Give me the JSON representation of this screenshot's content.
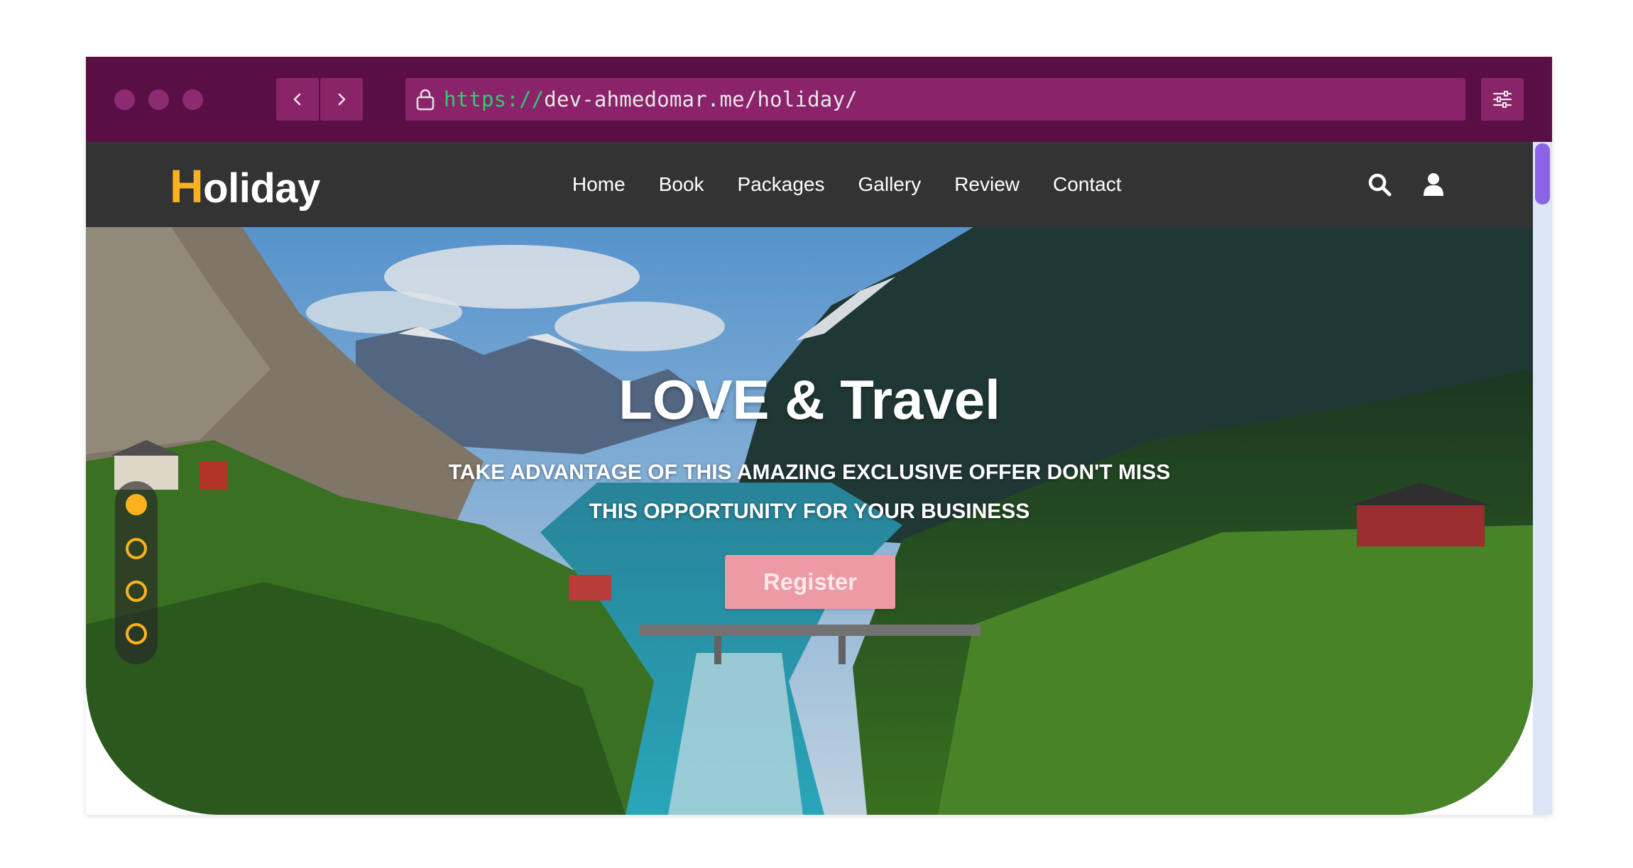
{
  "browser": {
    "url_protocol": "https://",
    "url_rest": "dev-ahmedomar.me/holiday/",
    "colors": {
      "frame": "#5a0f44",
      "control": "#8a2469"
    }
  },
  "site": {
    "logo_initial": "H",
    "logo_rest": "oliday",
    "nav": [
      "Home",
      "Book",
      "Packages",
      "Gallery",
      "Review",
      "Contact"
    ],
    "colors": {
      "accent": "#fcb21f",
      "navbar": "#333333",
      "button": "#ee9aa4"
    }
  },
  "hero": {
    "title": "LOVE & Travel",
    "subtitle_line1": "TAKE ADVANTAGE OF THIS AMAZING EXCLUSIVE OFFER DON'T MISS",
    "subtitle_line2": "THIS OPPORTUNITY FOR YOUR BUSINESS",
    "register_label": "Register"
  },
  "slider": {
    "count": 4,
    "active_index": 0
  },
  "icons": [
    "lock-icon",
    "chevron-left-icon",
    "chevron-right-icon",
    "sliders-icon",
    "search-icon",
    "user-icon"
  ]
}
